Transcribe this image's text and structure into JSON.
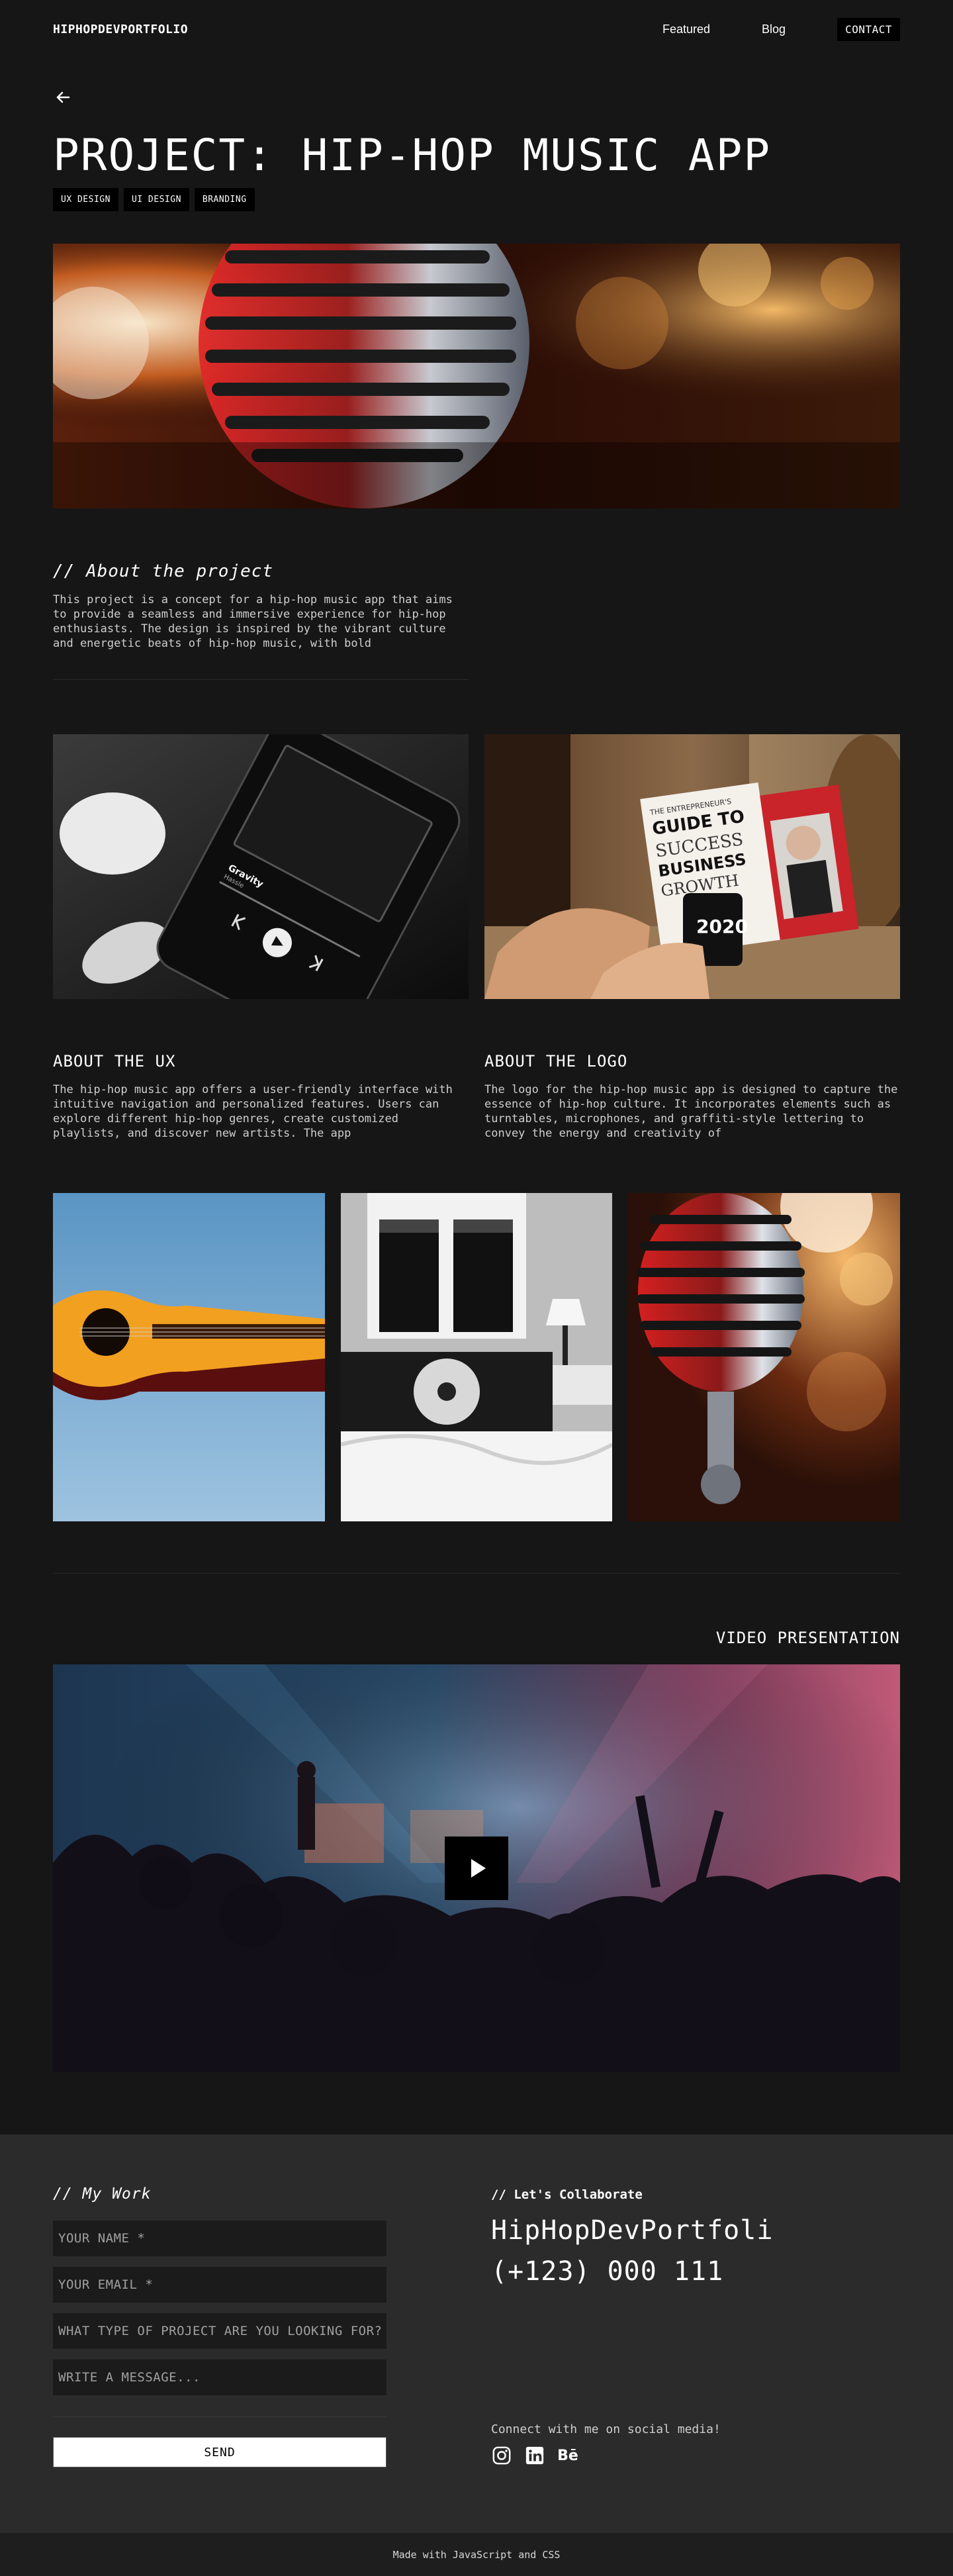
{
  "header": {
    "logo": "HIPHOPDEVPORTFOLIO",
    "nav": [
      "Featured",
      "Blog",
      "CONTACT"
    ]
  },
  "project": {
    "title": "PROJECT: HIP-HOP MUSIC APP",
    "tags": [
      "UX DESIGN",
      "UI DESIGN",
      "BRANDING"
    ]
  },
  "about": {
    "heading": "// About the project",
    "text": "This project is a concept for a hip-hop music app that aims to provide a seamless and immersive experience for hip-hop enthusiasts. The design is inspired by the vibrant culture and energetic beats of hip-hop music, with bold"
  },
  "ux": {
    "heading": "ABOUT THE UX",
    "text": "The hip-hop music app offers a user-friendly interface with intuitive navigation and personalized features. Users can explore different hip-hop genres, create customized playlists, and discover new artists. The app"
  },
  "logo_section": {
    "heading": "ABOUT THE LOGO",
    "text": "The logo for the hip-hop music app is designed to capture the essence of hip-hop culture. It incorporates elements such as turntables, microphones, and graffiti-style lettering to convey the energy and creativity of"
  },
  "phone_screen": {
    "track": "Gravity",
    "artist": "Hassle"
  },
  "book": {
    "line1": "THE ENTREPRENEUR'S",
    "line2": "GUIDE TO",
    "line3": "SUCCESS",
    "line4": "BUSINESS",
    "line5": "GROWTH",
    "mug": "2020"
  },
  "video": {
    "heading": "VIDEO PRESENTATION"
  },
  "footer": {
    "work_heading": "// My Work",
    "fields": [
      "YOUR NAME *",
      "YOUR EMAIL *",
      "WHAT TYPE OF PROJECT ARE YOU LOOKING FOR?",
      "WRITE A MESSAGE..."
    ],
    "send": "SEND",
    "collab": "// Let's Collaborate",
    "brand": "HipHopDevPortfoli",
    "phone": "(+123) 000 111",
    "social_label": "Connect with me on social media!",
    "socials": [
      "instagram",
      "linkedin",
      "behance"
    ],
    "behance_text": "Bē",
    "made_with": "Made with JavaScript and CSS"
  }
}
